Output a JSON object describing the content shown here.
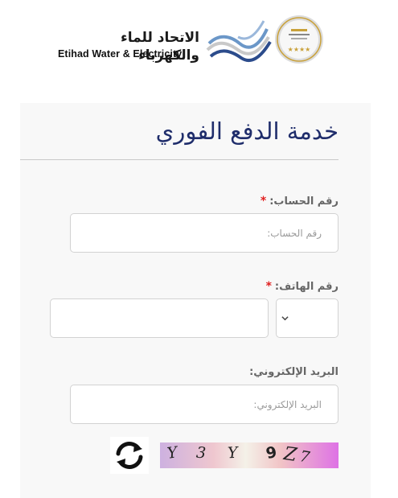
{
  "header": {
    "logo_ar": "الاتحاد للماء والكهرباء",
    "logo_en": "Etihad Water & Electricity"
  },
  "page": {
    "title": "خدمة الدفع الفوري"
  },
  "form": {
    "account": {
      "label": "رقم الحساب:",
      "required_mark": "*",
      "placeholder": "رقم الحساب:"
    },
    "phone": {
      "label": "رقم الهاتف:",
      "required_mark": "*",
      "placeholder": "",
      "country_code": ""
    },
    "email": {
      "label": "البريد الإلكتروني:",
      "placeholder": "البريد الإلكتروني:"
    }
  },
  "captcha": {
    "chars": [
      "Y",
      "3",
      "Y",
      "9",
      "Z",
      "7"
    ],
    "refresh_icon": "refresh-icon"
  },
  "colors": {
    "title": "#1f2d6b",
    "required": "#e02020",
    "brand_blue": "#2c4c8c",
    "gold": "#c9a13a"
  }
}
